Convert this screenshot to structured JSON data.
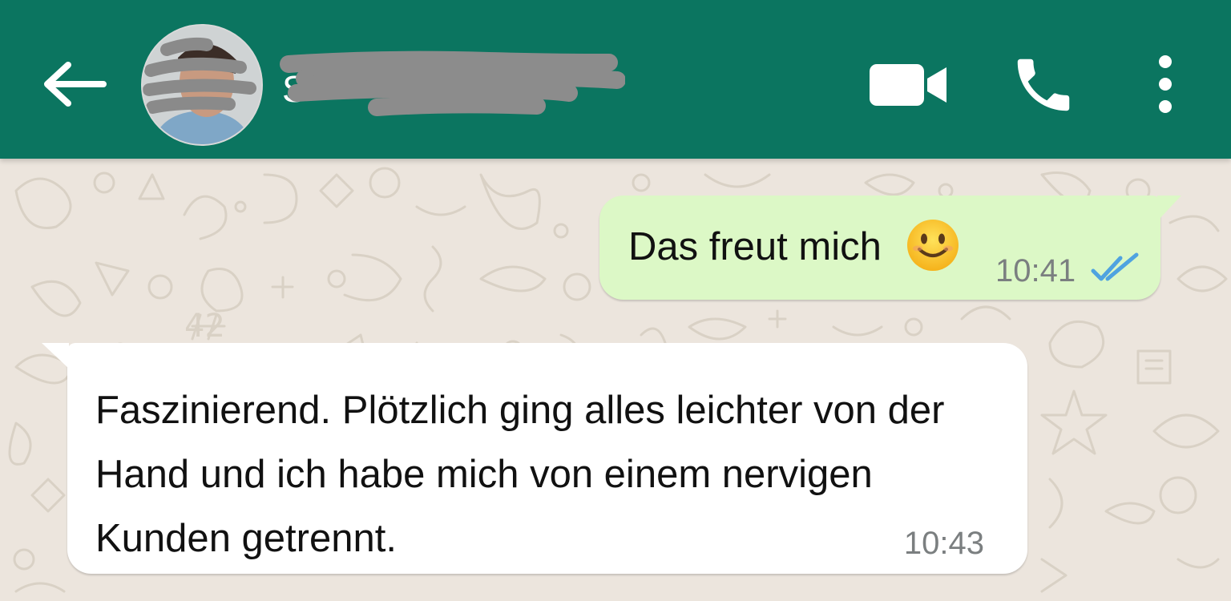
{
  "colors": {
    "header": "#0b7560",
    "wallpaper": "#ece5dd",
    "outgoing_bubble": "#dcf8c6",
    "incoming_bubble": "#ffffff",
    "read_ticks": "#4fa3e0",
    "timestamp": "#7b7f80"
  },
  "header": {
    "contact_name": "S",
    "contact_name_redacted": true,
    "avatar_redacted": true,
    "icons": [
      "back-arrow-icon",
      "video-call-icon",
      "voice-call-icon",
      "more-options-icon"
    ]
  },
  "messages": [
    {
      "direction": "outgoing",
      "text": "Das freut mich",
      "emoji": "smiling-face-emoji",
      "time": "10:41",
      "status": "read"
    },
    {
      "direction": "incoming",
      "text": "Faszinierend. Plötzlich ging alles leichter von der Hand und ich habe mich von einem nervigen Kunden getrennt.",
      "time": "10:43"
    }
  ]
}
